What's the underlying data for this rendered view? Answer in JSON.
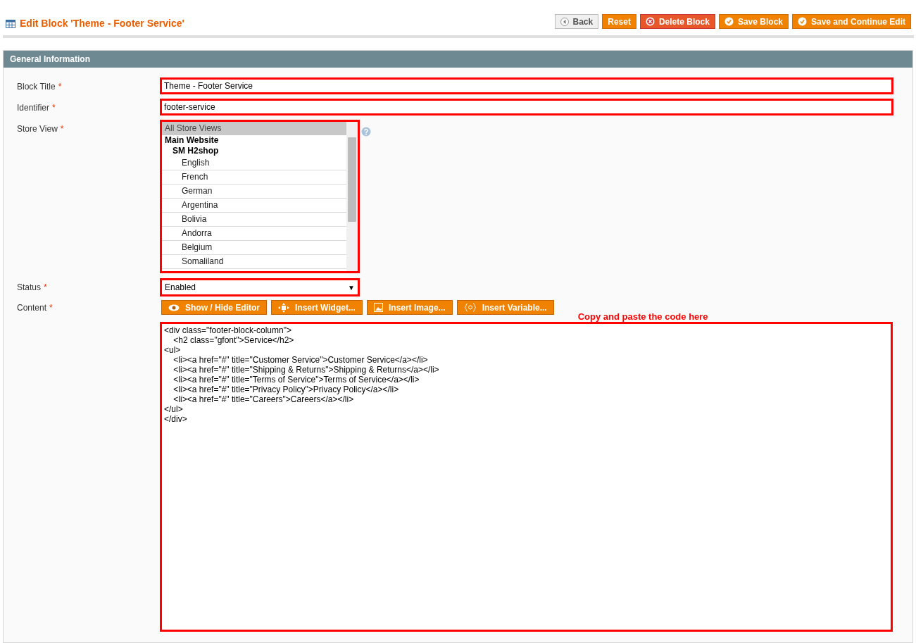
{
  "header": {
    "title": "Edit Block 'Theme - Footer Service'"
  },
  "actions": [
    {
      "kind": "back",
      "label": "Back"
    },
    {
      "kind": "reset",
      "label": "Reset"
    },
    {
      "kind": "delete",
      "label": "Delete Block"
    },
    {
      "kind": "save",
      "label": "Save Block"
    },
    {
      "kind": "save",
      "label": "Save and Continue Edit"
    }
  ],
  "section": {
    "title": "General Information"
  },
  "fields": {
    "block_title": {
      "label": "Block Title",
      "required_mark": "*",
      "value": "Theme - Footer Service",
      "highlighted": true
    },
    "identifier": {
      "label": "Identifier",
      "required_mark": "*",
      "value": "footer-service",
      "highlighted": true
    },
    "store_view": {
      "label": "Store View",
      "required_mark": "*",
      "highlighted": true,
      "options": [
        {
          "label": "All Store Views",
          "selected": true
        },
        {
          "label": "Main Website",
          "selected": false,
          "children": [
            {
              "label": "SM H2shop",
              "selected": false,
              "children": [
                {
                  "label": "English",
                  "selected": false
                },
                {
                  "label": "French",
                  "selected": false
                },
                {
                  "label": "German",
                  "selected": false
                },
                {
                  "label": "Argentina",
                  "selected": false
                },
                {
                  "label": "Bolivia",
                  "selected": false
                },
                {
                  "label": "Andorra",
                  "selected": false
                },
                {
                  "label": "Belgium",
                  "selected": false
                },
                {
                  "label": "Somaliland",
                  "selected": false
                }
              ]
            }
          ]
        }
      ]
    },
    "status": {
      "label": "Status",
      "required_mark": "*",
      "value": "Enabled",
      "arrow": "▼",
      "highlighted": true
    },
    "content": {
      "label": "Content",
      "required_mark": "*",
      "highlighted": true,
      "editor_buttons": [
        {
          "kind": "eye",
          "label": "Show / Hide Editor"
        },
        {
          "kind": "widget",
          "label": "Insert Widget..."
        },
        {
          "kind": "image",
          "label": "Insert Image..."
        },
        {
          "kind": "variable",
          "label": "Insert Variable..."
        }
      ],
      "annotation": "Copy and paste the code here",
      "value": "<div class=\"footer-block-column\">\n\t<h2 class=\"gfont\">Service</h2>\n<ul>\n\t<li><a href=\"#\" title=\"Customer Service\">Customer Service</a></li>\n\t<li><a href=\"#\" title=\"Shipping & Returns\">Shipping & Returns</a></li>\n\t<li><a href=\"#\" title=\"Terms of Service\">Terms of Service</a></li>\n\t<li><a href=\"#\" title=\"Privacy Policy\">Privacy Policy</a></li>\n\t<li><a href=\"#\" title=\"Careers\">Careers</a></li>\n</ul>\n</div>"
    }
  }
}
